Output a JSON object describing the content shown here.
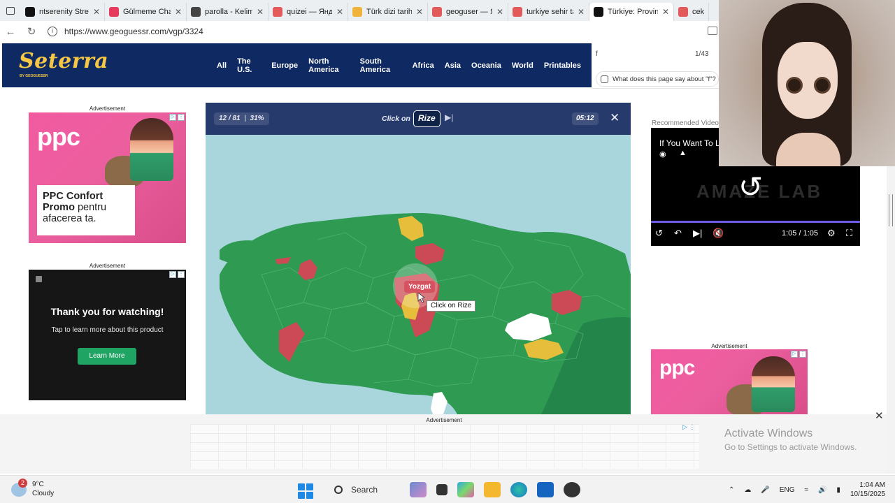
{
  "browser": {
    "tabs": [
      {
        "label": "ntserenity Stre",
        "color": "#111111"
      },
      {
        "label": "Gülmeme Chal",
        "color": "#e53b5c"
      },
      {
        "label": "parolla - Kelim",
        "color": "#444444"
      },
      {
        "label": "quizei — Янде",
        "color": "#e25a5a"
      },
      {
        "label": "Türk dizi tarihi",
        "color": "#f0b43c"
      },
      {
        "label": "geoguser — Я",
        "color": "#e25a5a"
      },
      {
        "label": "turkiye sehir ta",
        "color": "#e25a5a"
      },
      {
        "label": "Türkiye: Provin",
        "color": "#111111",
        "active": true
      },
      {
        "label": "cek b",
        "color": "#e25a5a"
      }
    ],
    "url": "https://www.geoguessr.com/vgp/3324"
  },
  "site": {
    "logo": "Seterra",
    "logo_sub": "BY GEOGUESSR",
    "nav": [
      "All",
      "The U.S.",
      "Europe",
      "North America",
      "South America",
      "Africa",
      "Asia",
      "Oceania",
      "World",
      "Printables"
    ]
  },
  "findbar": {
    "query": "f",
    "count": "1/43",
    "ask": "What does this page say about \"f\"?"
  },
  "ads": {
    "label": "Advertisement",
    "ppc_logo": "ppc",
    "ppc_line1": "PPC Confort",
    "ppc_line2": "Promo",
    "ppc_line3": "pentru afacerea ta.",
    "thanks_title": "Thank you for watching!",
    "thanks_sub": "Tap to learn more about this product",
    "thanks_button": "Learn More"
  },
  "game": {
    "progress": "12 / 81",
    "percent": "31%",
    "click_on": "Click on",
    "target": "Rize",
    "timer": "05:12",
    "hover_label": "Yozgat",
    "cursor_hint": "Click on Rize"
  },
  "video": {
    "recommended": "Recommended Video",
    "title": "If You Want To L",
    "brand": "AMAZE LAB",
    "time": "1:05 / 1:05"
  },
  "windows": {
    "activate_title": "Activate Windows",
    "activate_sub": "Go to Settings to activate Windows."
  },
  "taskbar": {
    "weather_badge": "2",
    "temp": "9°C",
    "condition": "Cloudy",
    "search": "Search",
    "lang": "ENG",
    "time": "1:04 AM",
    "date": "10/15/2025"
  },
  "colors": {
    "header": "#0f2a63",
    "logo": "#f6c744",
    "map_green": "#2e9a52",
    "map_red": "#cc4a55",
    "map_yellow": "#e6be3c",
    "sea": "#a9d5dd"
  }
}
